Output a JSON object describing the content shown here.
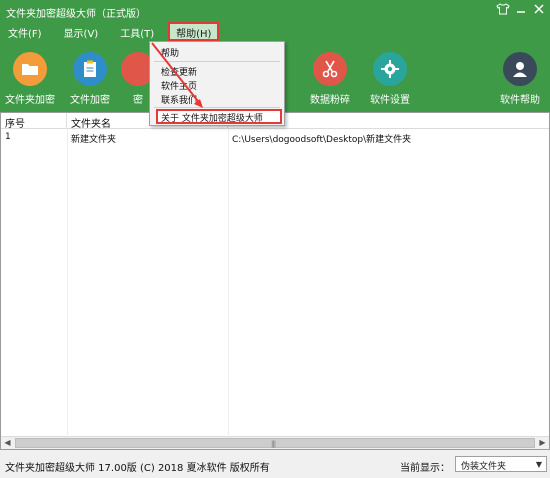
{
  "window": {
    "title": "文件夹加密超级大师（正式版）",
    "controls": [
      "shirt-icon",
      "minimize",
      "close"
    ]
  },
  "menu": {
    "items": [
      {
        "label": "文件(F)"
      },
      {
        "label": "显示(V)"
      },
      {
        "label": "工具(T)"
      },
      {
        "label": "帮助(H)"
      }
    ]
  },
  "toolbar": {
    "items": [
      {
        "label": "文件夹加密",
        "icon": "folder-icon"
      },
      {
        "label": "文件加密",
        "icon": "clipboard-icon"
      },
      {
        "label": "密",
        "icon": "lock-icon"
      },
      {
        "label": "数据粉碎",
        "icon": "scissors-icon"
      },
      {
        "label": "软件设置",
        "icon": "gear-icon"
      },
      {
        "label": "软件帮助",
        "icon": "user-icon"
      }
    ]
  },
  "help_menu": {
    "items": [
      {
        "label": "帮助"
      },
      {
        "label": "检查更新"
      },
      {
        "label": "软件主页"
      },
      {
        "label": "联系我们"
      },
      {
        "label": "关于 文件夹加密超级大师"
      }
    ]
  },
  "table": {
    "headers": [
      "序号",
      "文件夹名",
      ""
    ],
    "rows": [
      [
        "1",
        "新建文件夹",
        "C:\\Users\\dogoodsoft\\Desktop\\新建文件夹"
      ]
    ]
  },
  "status": {
    "text": "文件夹加密超级大师 17.00版 (C) 2018 夏冰软件 版权所有",
    "display_label": "当前显示：",
    "display_value": "伪装文件夹"
  },
  "colors": {
    "window_green": "#3f9a48",
    "highlight_red": "#e53935"
  }
}
